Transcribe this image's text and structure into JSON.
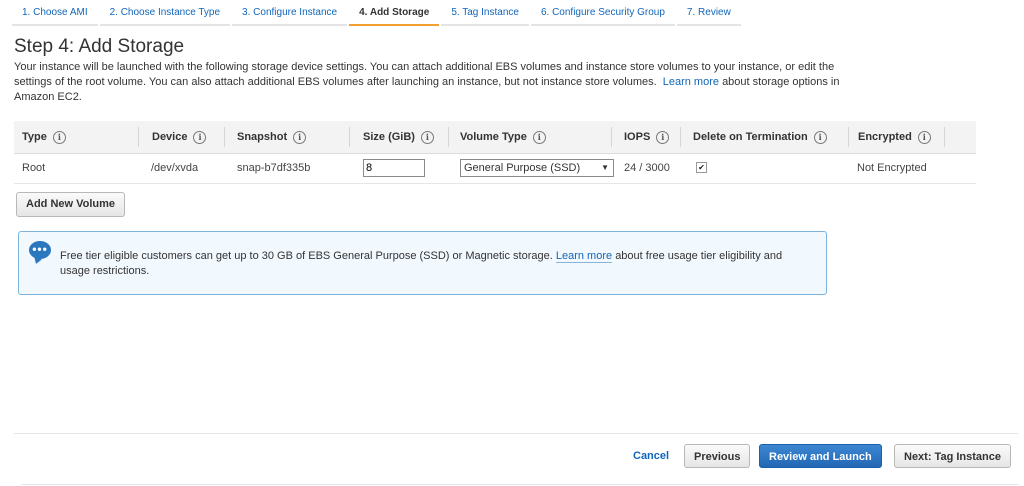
{
  "wizard": {
    "tabs": [
      {
        "label": "1. Choose AMI"
      },
      {
        "label": "2. Choose Instance Type"
      },
      {
        "label": "3. Configure Instance"
      },
      {
        "label": "4. Add Storage"
      },
      {
        "label": "5. Tag Instance"
      },
      {
        "label": "6. Configure Security Group"
      },
      {
        "label": "7. Review"
      }
    ],
    "active_index": 3
  },
  "page": {
    "title": "Step 4: Add Storage",
    "description": "Your instance will be launched with the following storage device settings. You can attach additional EBS volumes and instance store volumes to your instance, or edit the settings of the root volume. You can also attach additional EBS volumes after launching an instance, but not instance store volumes.",
    "learn_more": "Learn more",
    "description_tail": "about storage options in Amazon EC2."
  },
  "table": {
    "headers": {
      "type": "Type",
      "device": "Device",
      "snapshot": "Snapshot",
      "size": "Size (GiB)",
      "volume_type": "Volume Type",
      "iops": "IOPS",
      "delete_on_termination": "Delete on Termination",
      "encrypted": "Encrypted"
    },
    "info_glyph": "i",
    "rows": [
      {
        "type": "Root",
        "device": "/dev/xvda",
        "snapshot": "snap-b7df335b",
        "size": "8",
        "volume_type": "General Purpose (SSD)",
        "iops": "24 / 3000",
        "delete_on_termination": true,
        "encrypted": "Not Encrypted"
      }
    ]
  },
  "add_volume_label": "Add New Volume",
  "info_box": {
    "icon": "chat-bubble-icon",
    "text_before": "Free tier eligible customers can get up to 30 GB of EBS General Purpose (SSD) or Magnetic storage.",
    "link": "Learn more",
    "text_after": "about free usage tier eligibility and usage restrictions."
  },
  "footer": {
    "cancel": "Cancel",
    "previous": "Previous",
    "review_launch": "Review and Launch",
    "next": "Next: Tag Instance"
  },
  "colors": {
    "link": "#1166bb",
    "active_tab_underline": "#f0a030",
    "primary_button": "#2b77bd",
    "info_border": "#7eb3dc"
  }
}
